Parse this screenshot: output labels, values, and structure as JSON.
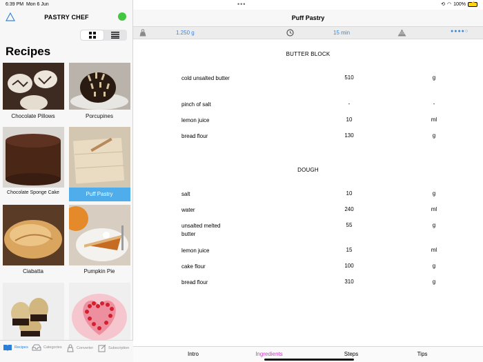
{
  "status": {
    "time": "6:39 PM",
    "date": "Mon 6 Jun",
    "battery": "100%"
  },
  "sidebar": {
    "app_title": "PASTRY CHEF",
    "heading": "Recipes",
    "recipes": [
      {
        "label": "Chocolate Pillows"
      },
      {
        "label": "Porcupines"
      },
      {
        "label": "Chocolate Sponge Cake"
      },
      {
        "label": "Puff Pastry",
        "selected": true
      },
      {
        "label": "Ciabatta"
      },
      {
        "label": "Pumpkin Pie"
      },
      {
        "label": ""
      },
      {
        "label": ""
      }
    ],
    "tabs": [
      {
        "label": "Recipes",
        "icon": "book-icon",
        "active": true
      },
      {
        "label": "Categories",
        "icon": "tray-icon"
      },
      {
        "label": "Converter",
        "icon": "scale-icon"
      },
      {
        "label": "Subscription",
        "icon": "edit-icon"
      }
    ]
  },
  "main": {
    "title": "Puff Pastry",
    "info": {
      "weight": "1.250 g",
      "time": "15 min"
    },
    "sections": [
      {
        "title": "BUTTER BLOCK",
        "rows": [
          {
            "name": "cold unsalted butter",
            "qty": "510",
            "unit": "g"
          },
          {
            "name": "pinch of salt",
            "qty": "-",
            "unit": "-"
          },
          {
            "name": "lemon juice",
            "qty": "10",
            "unit": "ml"
          },
          {
            "name": "bread flour",
            "qty": "130",
            "unit": "g"
          }
        ]
      },
      {
        "title": "DOUGH",
        "rows": [
          {
            "name": "salt",
            "qty": "10",
            "unit": "g"
          },
          {
            "name": "water",
            "qty": "240",
            "unit": "ml"
          },
          {
            "name": "unsalted melted butter",
            "qty": "55",
            "unit": "g"
          },
          {
            "name": "lemon juice",
            "qty": "15",
            "unit": "ml"
          },
          {
            "name": "cake flour",
            "qty": "100",
            "unit": "g"
          },
          {
            "name": "bread flour",
            "qty": "310",
            "unit": "g"
          }
        ]
      }
    ],
    "tabs": [
      {
        "label": "Intro"
      },
      {
        "label": "Ingredients",
        "active": true
      },
      {
        "label": "Steps"
      },
      {
        "label": "Tips"
      }
    ]
  },
  "colors": {
    "accent": "#3a86d4",
    "selection": "#4eadea",
    "active_tab": "#d634d1",
    "status_dot": "#41c840"
  }
}
